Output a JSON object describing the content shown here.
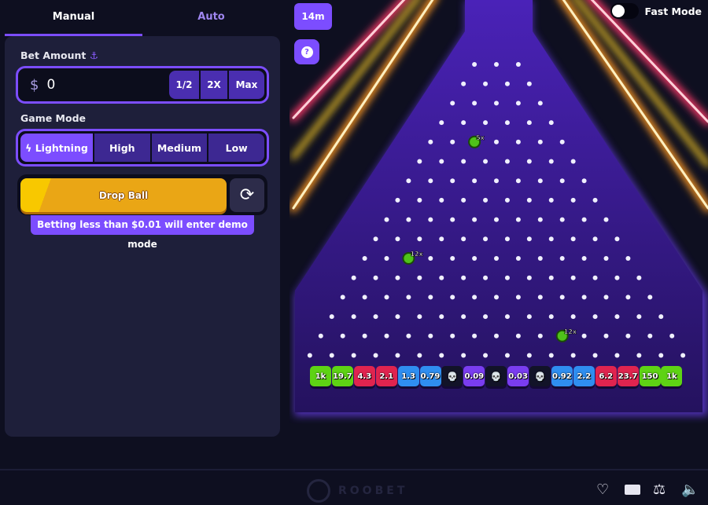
{
  "tabs": {
    "manual": "Manual",
    "auto": "Auto"
  },
  "bet": {
    "label": "Bet Amount",
    "currency": "$",
    "value": "0",
    "half": "1/2",
    "double": "2X",
    "max": "Max"
  },
  "game_mode": {
    "label": "Game Mode",
    "options": [
      "Lightning",
      "High",
      "Medium",
      "Low"
    ],
    "selected": "Lightning"
  },
  "drop_button": "Drop Ball",
  "demo_notice": "Betting less than $0.01 will enter demo mode",
  "board": {
    "rows_badge": "14m",
    "help": "?",
    "fast_mode": "Fast Mode",
    "fast_mode_on": false,
    "multipliers": [
      "1k",
      "19.7",
      "4.3",
      "2.1",
      "1.3",
      "0.79",
      "skull",
      "0.09",
      "skull",
      "0.03",
      "skull",
      "0.92",
      "2.2",
      "6.2",
      "23.7",
      "150",
      "1k"
    ],
    "slot_colors": [
      "#5ed314",
      "#5ed314",
      "#e0244f",
      "#e0244f",
      "#2f8ef0",
      "#2f8ef0",
      "#121328",
      "#7a3df0",
      "#121328",
      "#7a3df0",
      "#121328",
      "#2f8ef0",
      "#2f8ef0",
      "#e0244f",
      "#e0244f",
      "#5ed314",
      "#5ed314"
    ],
    "lightning_pegs": [
      {
        "row": 4,
        "index": 2,
        "label": "5x"
      },
      {
        "row": 10,
        "index": 2,
        "label": "12x"
      },
      {
        "row": 14,
        "index": 11,
        "label": "12x"
      }
    ]
  },
  "footer": {
    "brand": "ROOBET",
    "icons": [
      "heart-icon",
      "keyboard-icon",
      "balance-scale-icon",
      "volume-icon"
    ]
  }
}
